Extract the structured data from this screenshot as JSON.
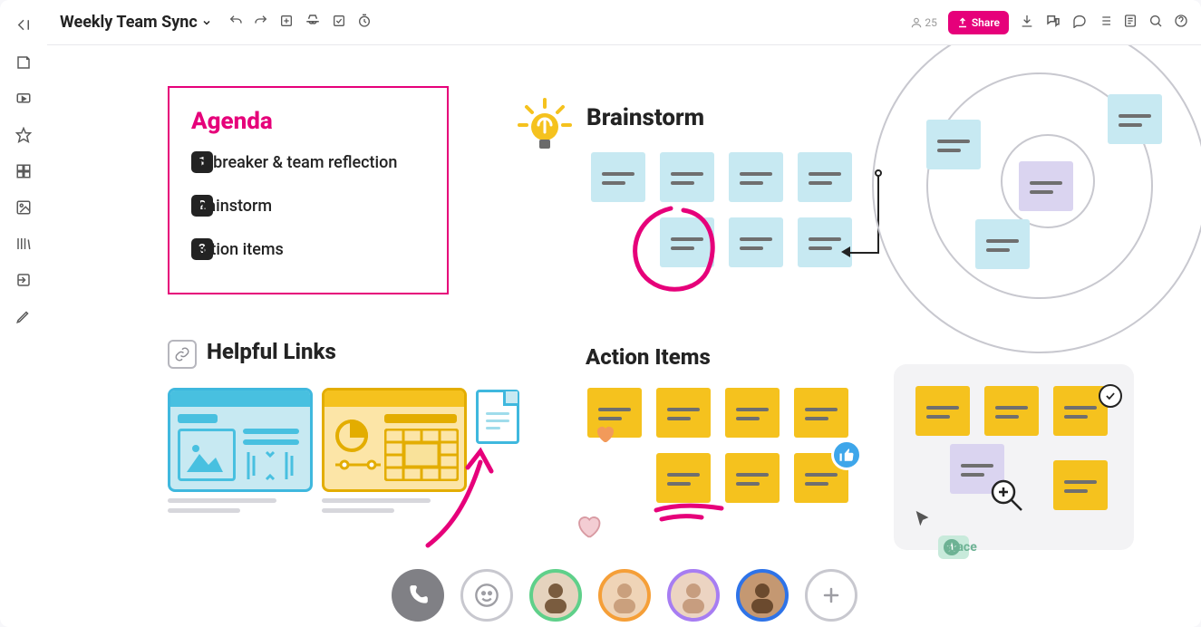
{
  "doc_title": "Weekly Team Sync",
  "presence_count": "25",
  "share_label": "Share",
  "agenda": {
    "heading": "Agenda",
    "items": [
      "Icebreaker & team reflection",
      "Brainstorm",
      "Action items"
    ]
  },
  "sections": {
    "helpful_links": "Helpful Links",
    "brainstorm": "Brainstorm",
    "action_items": "Action Items"
  },
  "user_label": "Grace",
  "colors": {
    "accent_pink": "#e6007a",
    "sticky_sky": "#c7e9f2",
    "sticky_gold": "#f5c21e",
    "sticky_lilac": "#dad4f0"
  }
}
